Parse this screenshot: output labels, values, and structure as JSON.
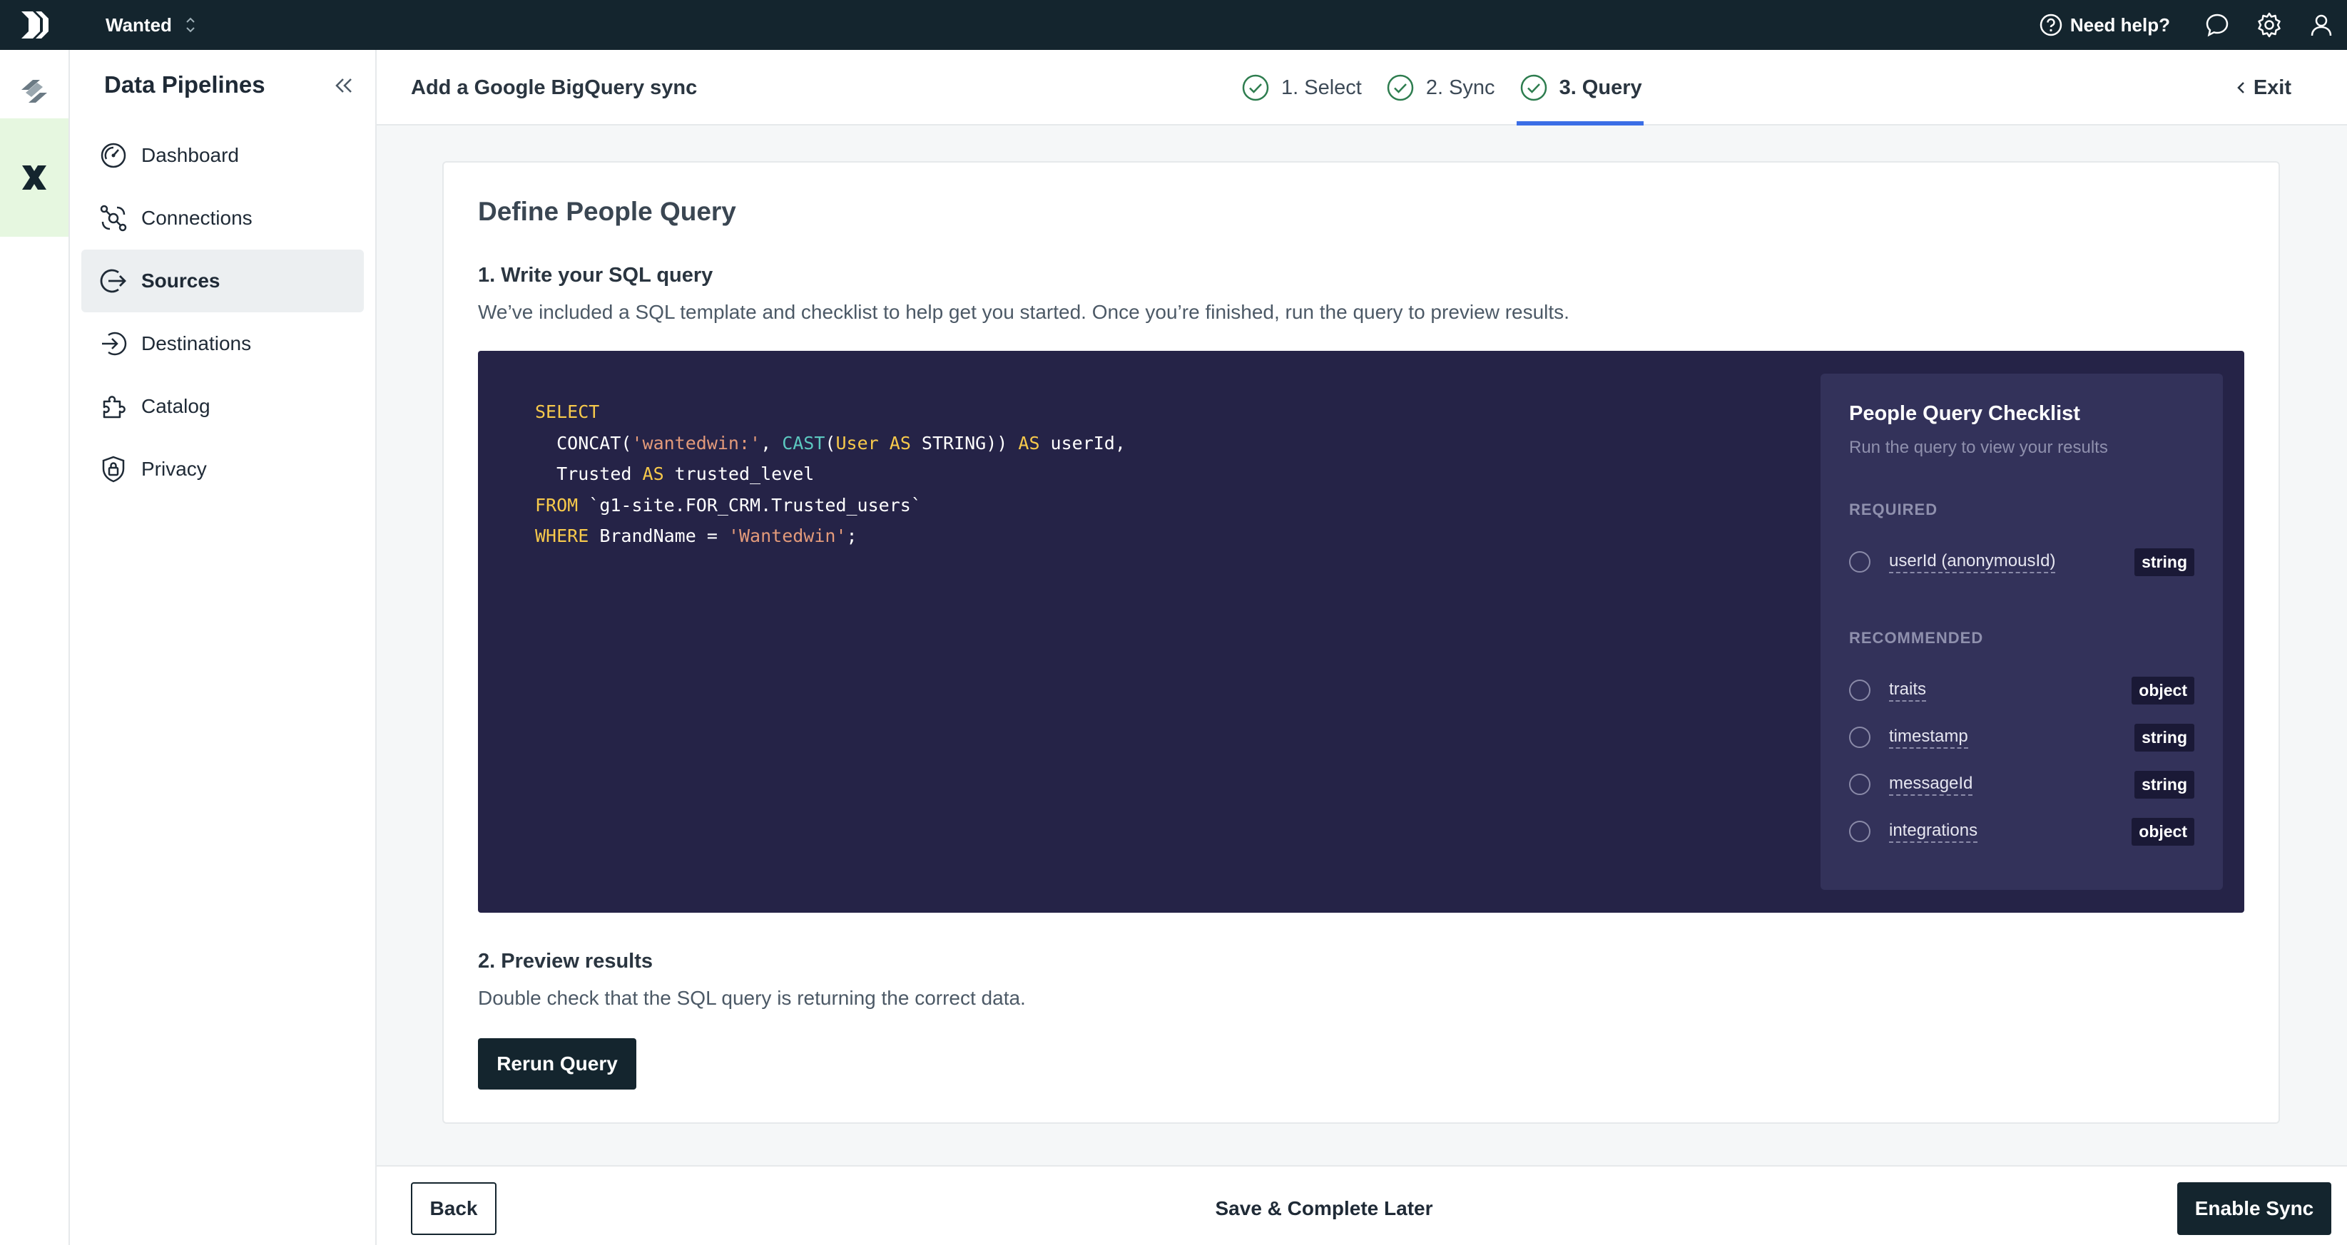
{
  "topbar": {
    "workspace": "Wanted",
    "help_label": "Need help?",
    "icons": [
      "logo-icon",
      "workspace-switch-icon",
      "help-icon",
      "chat-icon",
      "gear-icon",
      "user-icon"
    ]
  },
  "rail": {
    "items": [
      {
        "icon": "connections-product-icon"
      },
      {
        "icon": "data-pipelines-product-icon",
        "active": true
      }
    ]
  },
  "sidebar": {
    "title": "Data Pipelines",
    "items": [
      {
        "label": "Dashboard",
        "icon": "dashboard-icon"
      },
      {
        "label": "Connections",
        "icon": "connections-icon"
      },
      {
        "label": "Sources",
        "icon": "sources-icon",
        "active": true
      },
      {
        "label": "Destinations",
        "icon": "destinations-icon"
      },
      {
        "label": "Catalog",
        "icon": "catalog-icon"
      },
      {
        "label": "Privacy",
        "icon": "privacy-icon"
      }
    ]
  },
  "header": {
    "title": "Add a Google BigQuery sync",
    "steps": [
      {
        "label": "1. Select",
        "done": true
      },
      {
        "label": "2. Sync",
        "done": true
      },
      {
        "label": "3. Query",
        "done": true,
        "active": true
      }
    ],
    "exit_label": "Exit"
  },
  "card": {
    "title": "Define People Query",
    "section1_title": "1. Write your SQL query",
    "section1_desc": "We’ve included a SQL template and checklist to help get you started. Once you’re finished, run the query to preview results.",
    "section2_title": "2. Preview results",
    "section2_desc": "Double check that the SQL query is returning the correct data.",
    "rerun_label": "Rerun Query"
  },
  "sql": {
    "line1_kw": "SELECT",
    "line2_a": "  CONCAT(",
    "line2_str": "'wantedwin:'",
    "line2_b": ", ",
    "line2_fn": "CAST",
    "line2_c": "(",
    "line2_kw1": "User",
    "line2_d": " ",
    "line2_kw2": "AS",
    "line2_e": " STRING)) ",
    "line2_kw3": "AS",
    "line2_f": " userId,",
    "line3_a": "  Trusted ",
    "line3_kw": "AS",
    "line3_b": " trusted_level",
    "line4_kw": "FROM",
    "line4_a": " `g1-site.FOR_CRM.Trusted_users`",
    "line5_kw": "WHERE",
    "line5_a": " BrandName = ",
    "line5_str": "'Wantedwin'",
    "line5_b": ";"
  },
  "checklist": {
    "title": "People Query Checklist",
    "subtitle": "Run the query to view your results",
    "required_label": "REQUIRED",
    "recommended_label": "RECOMMENDED",
    "required": [
      {
        "label": "userId (anonymousId)",
        "type": "string"
      }
    ],
    "recommended": [
      {
        "label": "traits",
        "type": "object"
      },
      {
        "label": "timestamp",
        "type": "string"
      },
      {
        "label": "messageId",
        "type": "string"
      },
      {
        "label": "integrations",
        "type": "object"
      }
    ]
  },
  "footer": {
    "back_label": "Back",
    "later_label": "Save & Complete Later",
    "enable_label": "Enable Sync"
  },
  "colors": {
    "topbar": "#14252e",
    "editor_bg": "#252347",
    "checklist_bg": "#33325a",
    "step_check": "#2e7d4f",
    "active_step_underline": "#3b6ee6",
    "keyword": "#f7c94b",
    "function": "#5cc8c0",
    "string": "#e39a7a"
  }
}
